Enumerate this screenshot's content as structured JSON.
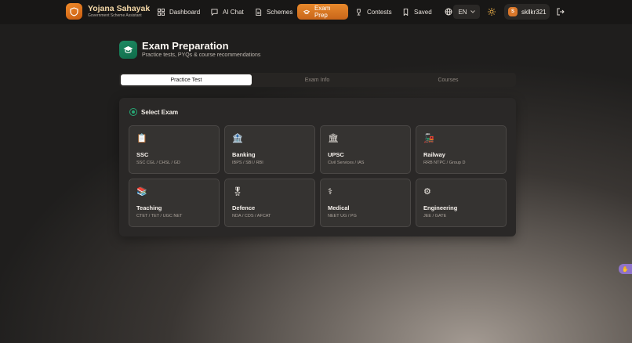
{
  "brand": {
    "title": "Yojana Sahayak",
    "subtitle": "Government Scheme Assistant"
  },
  "nav": {
    "items": [
      {
        "label": "Dashboard",
        "icon": "grid-icon"
      },
      {
        "label": "AI Chat",
        "icon": "chat-icon"
      },
      {
        "label": "Schemes",
        "icon": "document-icon"
      },
      {
        "label": "Exam Prep",
        "icon": "graduation-cap-icon",
        "active": true
      },
      {
        "label": "Contests",
        "icon": "trophy-icon"
      },
      {
        "label": "Saved",
        "icon": "bookmark-icon"
      }
    ],
    "language": "EN",
    "user": {
      "initial": "S",
      "name": "skllkr321"
    }
  },
  "page": {
    "title": "Exam Preparation",
    "subtitle": "Practice tests, PYQs & course recommendations"
  },
  "tabs": [
    {
      "label": "Practice Test",
      "active": true
    },
    {
      "label": "Exam Info"
    },
    {
      "label": "Courses"
    }
  ],
  "select": {
    "title": "Select Exam",
    "exams": [
      {
        "name": "SSC",
        "sub": "SSC CGL / CHSL / GD",
        "icon": "clipboard-icon",
        "glyph": "📋"
      },
      {
        "name": "Banking",
        "sub": "IBPS / SBI / RBI",
        "icon": "bank-icon",
        "glyph": "🏦"
      },
      {
        "name": "UPSC",
        "sub": "Civil Services / IAS",
        "icon": "classical-building-icon",
        "glyph": "🏛"
      },
      {
        "name": "Railway",
        "sub": "RRB NTPC / Group D",
        "icon": "train-icon",
        "glyph": "🚂"
      },
      {
        "name": "Teaching",
        "sub": "CTET / TET / UGC NET",
        "icon": "books-icon",
        "glyph": "📚"
      },
      {
        "name": "Defence",
        "sub": "NDA / CDS / AFCAT",
        "icon": "medal-icon",
        "glyph": "🎖"
      },
      {
        "name": "Medical",
        "sub": "NEET UG / PG",
        "icon": "stethoscope-icon",
        "glyph": "⚕"
      },
      {
        "name": "Engineering",
        "sub": "JEE / GATE",
        "icon": "gear-icon",
        "glyph": "⚙"
      }
    ]
  },
  "colors": {
    "accent": "#e07a22",
    "brand_green": "#168058",
    "active_tab": "#ffffff"
  }
}
